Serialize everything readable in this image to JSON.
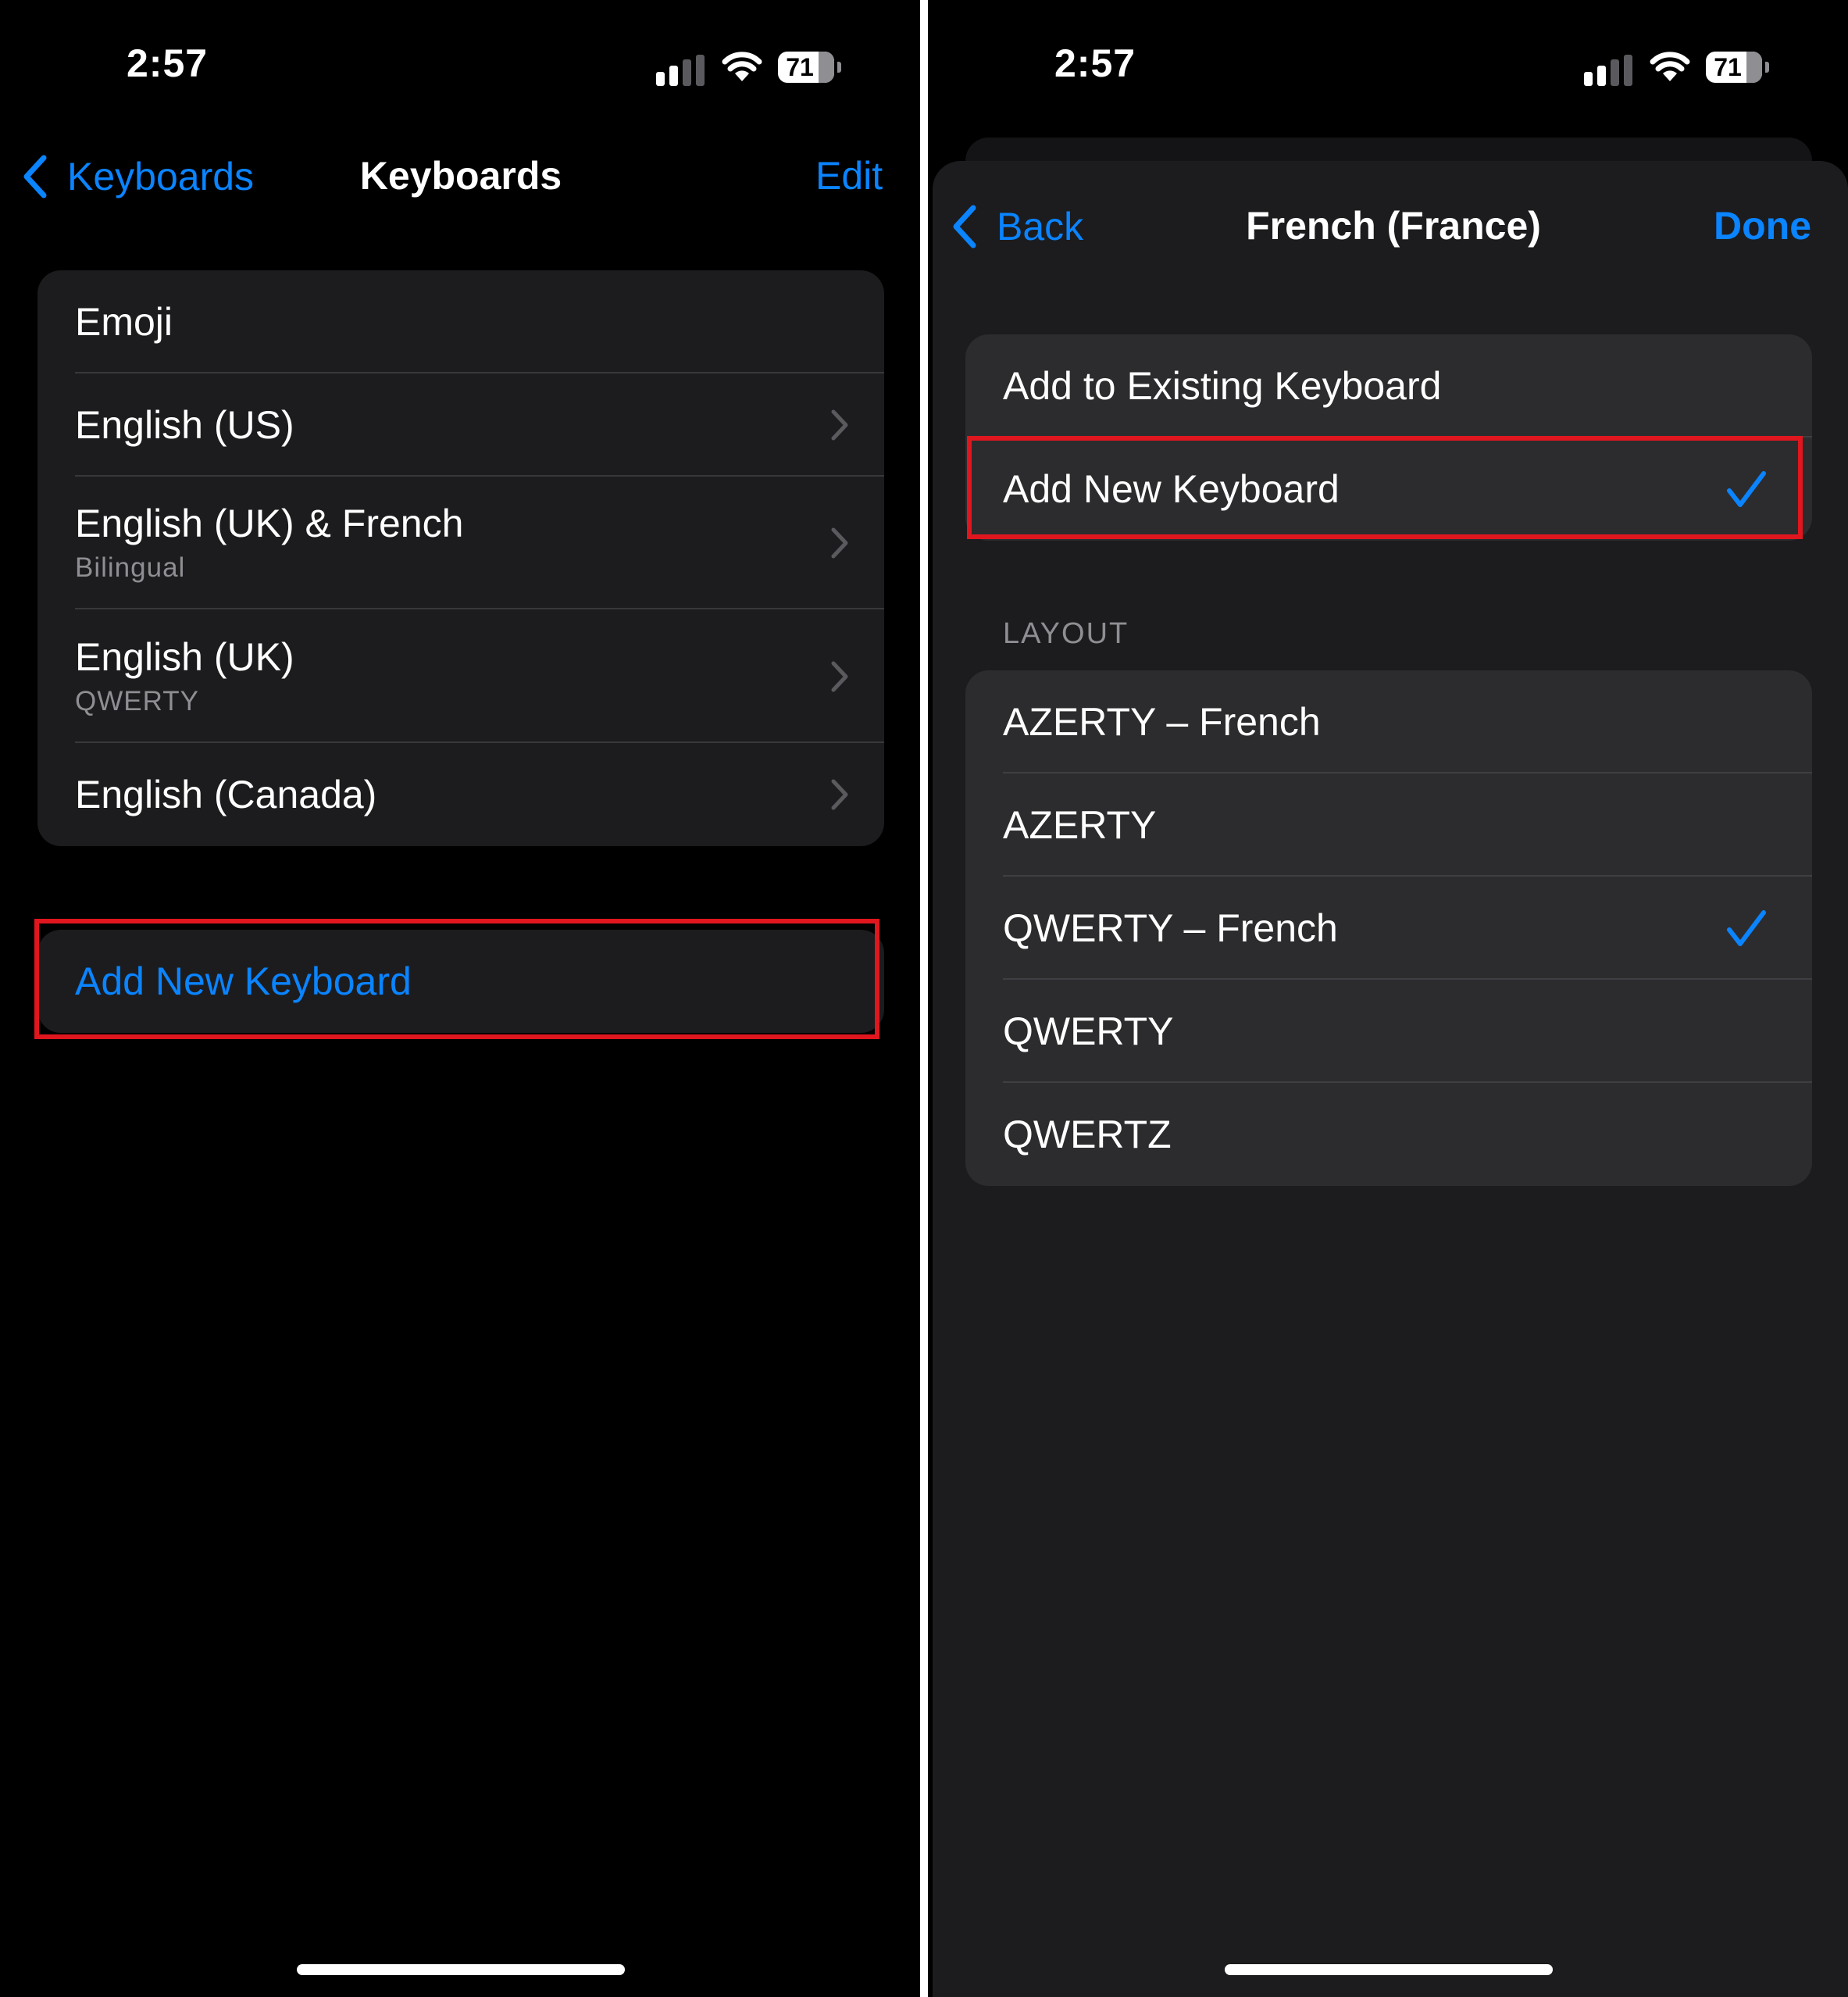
{
  "colors": {
    "accent": "#0a84ff",
    "highlight": "#e0161e",
    "background": "#000000",
    "cell": "#1c1c1e"
  },
  "left": {
    "status": {
      "time": "2:57",
      "battery": "71"
    },
    "nav": {
      "back_label": "Keyboards",
      "title": "Keyboards",
      "action_label": "Edit"
    },
    "keyboards": [
      {
        "label": "Emoji",
        "sublabel": ""
      },
      {
        "label": "English (US)",
        "sublabel": ""
      },
      {
        "label": "English (UK) & French",
        "sublabel": "Bilingual"
      },
      {
        "label": "English (UK)",
        "sublabel": "QWERTY"
      },
      {
        "label": "English (Canada)",
        "sublabel": ""
      }
    ],
    "add_new_label": "Add New Keyboard"
  },
  "right": {
    "status": {
      "time": "2:57",
      "battery": "71"
    },
    "nav": {
      "back_label": "Back",
      "title": "French (France)",
      "action_label": "Done"
    },
    "options": [
      {
        "label": "Add to Existing Keyboard",
        "selected": false
      },
      {
        "label": "Add New Keyboard",
        "selected": true
      }
    ],
    "layout_header": "LAYOUT",
    "layouts": [
      {
        "label": "AZERTY – French",
        "selected": false
      },
      {
        "label": "AZERTY",
        "selected": false
      },
      {
        "label": "QWERTY – French",
        "selected": true
      },
      {
        "label": "QWERTY",
        "selected": false
      },
      {
        "label": "QWERTZ",
        "selected": false
      }
    ]
  }
}
